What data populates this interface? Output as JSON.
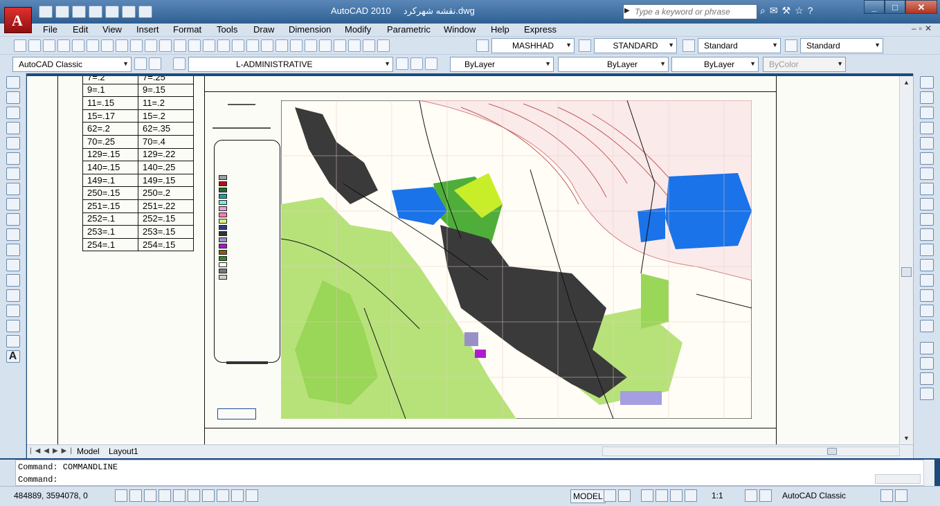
{
  "app": {
    "title": "AutoCAD 2010",
    "file_name": "نقشه شهرکرد.dwg",
    "logo_letter": "A",
    "search_placeholder": "Type a keyword or phrase"
  },
  "menu": [
    "File",
    "Edit",
    "View",
    "Insert",
    "Format",
    "Tools",
    "Draw",
    "Dimension",
    "Modify",
    "Parametric",
    "Window",
    "Help",
    "Express"
  ],
  "toolbar": {
    "text_style": "MASHHAD",
    "dim_style": "STANDARD",
    "table_style": "Standard",
    "multileader_style": "Standard",
    "workspace": "AutoCAD Classic",
    "layer": "L-ADMINISTRATIVE",
    "color": "ByLayer",
    "linetype": "ByLayer",
    "lineweight": "ByLayer",
    "plot_style": "ByColor"
  },
  "drawing": {
    "legend_rows": [
      [
        "7=.2",
        "7=.25"
      ],
      [
        "9=.1",
        "9=.15"
      ],
      [
        "11=.15",
        "11=.2"
      ],
      [
        "15=.17",
        "15=.2"
      ],
      [
        "62=.2",
        "62=.35"
      ],
      [
        "70=.25",
        "70=.4"
      ],
      [
        "129=.15",
        "129=.22"
      ],
      [
        "140=.15",
        "140=.25"
      ],
      [
        "149=.1",
        "149=.15"
      ],
      [
        "250=.15",
        "250=.2"
      ],
      [
        "251=.15",
        "251=.22"
      ],
      [
        "252=.1",
        "252=.15"
      ],
      [
        "253=.1",
        "253=.15"
      ],
      [
        "254=.1",
        "254=.15"
      ]
    ],
    "map_legend_swatches": [
      "#9aa0a0",
      "#b0101a",
      "#1e6a2a",
      "#1aa0a8",
      "#7fe6e0",
      "#e8a0d8",
      "#ff7fb0",
      "#d8f07a",
      "#2e3a8c",
      "#333333",
      "#9a90c8",
      "#a01ad0",
      "#8a5a1a",
      "#2a8a2a",
      "#ffffff",
      "#777777",
      "#cccccc"
    ]
  },
  "tabs": [
    "Model",
    "Layout1"
  ],
  "command": {
    "line1": "Command: COMMANDLINE",
    "line2": "Command:"
  },
  "status": {
    "coordinates": "484889, 3594078, 0",
    "model": "MODEL",
    "annotation_scale": "1:1",
    "workspace": "AutoCAD Classic"
  }
}
